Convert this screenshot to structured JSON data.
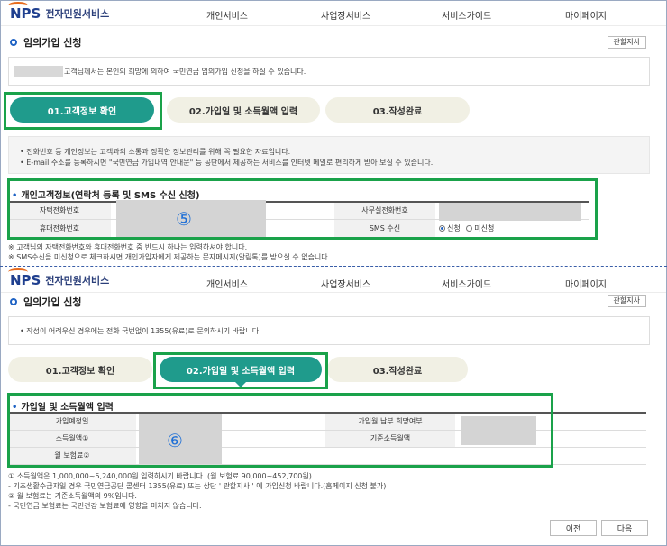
{
  "header": {
    "logo_mark": "NPS",
    "logo_text": "전자민원서비스",
    "nav": [
      "개인서비스",
      "사업장서비스",
      "서비스가이드",
      "마이페이지"
    ]
  },
  "page": {
    "title": "임의가입 신청",
    "office_button": "관할지사"
  },
  "panel1": {
    "notice": "고객님께서는 본인의 희망에 의하여 국민연금 임의가입 신청을 하실 수 있습니다.",
    "steps": [
      "01.고객정보 확인",
      "02.가입일 및 소득월액 입력",
      "03.작성완료"
    ],
    "info_lines": [
      "•  전화번호 등 개인정보는 고객과의 소통과 정확한 정보관리를 위해 꼭 필요한 자료입니다.",
      "•  E-mail 주소를 등록하시면 \"국민연금 가입내역 안내문\" 등 공단에서 제공하는 서비스를 인터넷 메일로 편리하게 받아 보실 수 있습니다."
    ],
    "section_title": "개인고객정보(연락처 등록 및 SMS 수신 신청)",
    "labels": {
      "home_phone": "자택전화번호",
      "mobile_phone": "휴대전화번호",
      "office_phone": "사무실전화번호",
      "sms": "SMS 수신"
    },
    "sms_options": [
      "신청",
      "미신청"
    ],
    "marker": "⑤",
    "notes": [
      "※ 고객님의 자택전화번호와 휴대전화번호 중 반드시 하나는 입력하셔야 합니다.",
      "※ SMS수신을 미신청으로 체크하시면 개인가입자에게 제공하는 문자메시지(알림톡)를 받으실 수 없습니다."
    ]
  },
  "panel2": {
    "notice": "•  작성이 어려우신 경우에는 전화 국번없이 1355(유료)로 문의하시기 바랍니다.",
    "steps": [
      "01.고객정보 확인",
      "02.가입일 및 소득월액 입력",
      "03.작성완료"
    ],
    "section_title": "가입일 및 소득월액 입력",
    "labels": {
      "join_date": "가입예정일",
      "monthly_income": "소득월액①",
      "premium": "월 보험료②",
      "pay_preference": "가입월 납부 희망여부",
      "base_income": "기준소득월액"
    },
    "marker": "⑥",
    "notes": [
      "① 소득월액은 1,000,000~5,240,000원 입력하시기 바랍니다. (월 보험료 90,000~452,700원)",
      "  - 기초생활수급자일 경우 국민연금공단 콜센터 1355(유료) 또는 상단 ' 관할지사 ' 에 가입신청 바랍니다.(홈페이지 신청 불가)",
      "② 월 보험료는 기준소득월액의 9%입니다.",
      "  - 국민연금 보험료는 국민건강 보험료에 영향을 미치지 않습니다."
    ],
    "buttons": {
      "prev": "이전",
      "next": "다음"
    }
  }
}
